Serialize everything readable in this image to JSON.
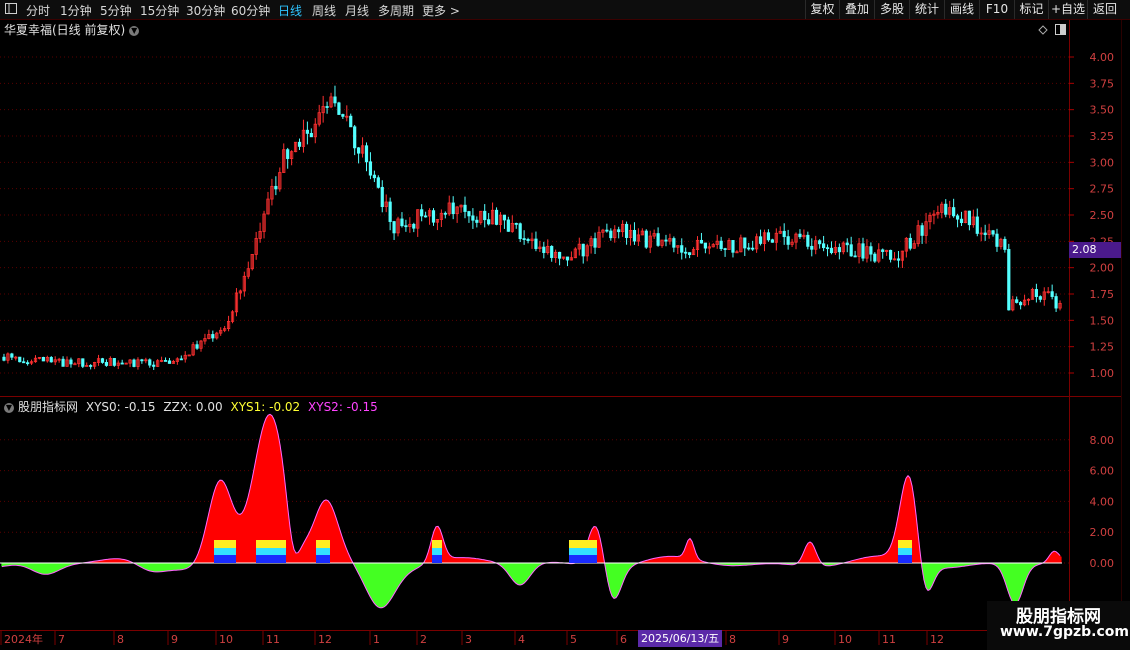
{
  "toolbar": {
    "periods": [
      "分时",
      "1分钟",
      "5分钟",
      "15分钟",
      "30分钟",
      "60分钟",
      "日线",
      "周线",
      "月线",
      "多周期",
      "更多 >"
    ],
    "active": "日线",
    "actions": [
      "复权",
      "叠加",
      "多股",
      "统计",
      "画线",
      "F10",
      "标记",
      "+自选",
      "返回"
    ]
  },
  "chart_header": {
    "title": "华夏幸福(日线 前复权)"
  },
  "price_axis": {
    "ticks": [
      "4.00",
      "3.75",
      "3.50",
      "3.25",
      "3.00",
      "2.75",
      "2.50",
      "2.25",
      "2.00",
      "1.75",
      "1.50",
      "1.25",
      "1.00"
    ],
    "current": "2.08"
  },
  "indicator": {
    "name": "股朋指标网",
    "xys0": "XYS0: -0.15",
    "zzx": "ZZX: 0.00",
    "xys1": "XYS1: -0.02",
    "xys2": "XYS2: -0.15",
    "ticks": [
      "8.00",
      "6.00",
      "4.00",
      "2.00",
      "0.00"
    ]
  },
  "time_axis": {
    "labels": [
      "2024年",
      "7",
      "8",
      "9",
      "10",
      "11",
      "12",
      "1",
      "2",
      "3",
      "4",
      "5",
      "6",
      "7",
      "8",
      "9",
      "10",
      "11",
      "12"
    ],
    "cursor_date": "2025/06/13/五"
  },
  "watermark": {
    "title": "股朋指标网",
    "url": "www.7gpzb.com"
  },
  "colors": {
    "up": "#ff3030",
    "down": "#54ffff",
    "bg": "#000000",
    "grid": "#5a0000",
    "accent": "#2ec4ff",
    "pos_area": "#ff0000",
    "neg_area": "#44ff22"
  },
  "chart_data": {
    "type": "candlestick",
    "title": "华夏幸福(日线 前复权)",
    "price_ylim": [
      0.95,
      4.15
    ],
    "months": [
      "2024-06",
      "7",
      "8",
      "9",
      "10",
      "11",
      "12",
      "2025-01",
      "2",
      "3",
      "4",
      "5",
      "6",
      "7",
      "8",
      "9",
      "10",
      "11",
      "12"
    ],
    "monthly_close_approx": [
      1.15,
      1.1,
      1.1,
      1.08,
      1.45,
      3.0,
      3.6,
      2.4,
      2.55,
      2.45,
      2.05,
      2.35,
      2.2,
      2.2,
      2.3,
      2.2,
      2.1,
      2.6,
      2.2
    ],
    "last_segment_close_approx": [
      1.6,
      1.8,
      1.65
    ],
    "indicator_series": {
      "name": "XYS0",
      "ylim": [
        -2.5,
        9.5
      ],
      "peaks": [
        {
          "month": "10",
          "value": 5.4
        },
        {
          "month": "11",
          "value": 9.5
        },
        {
          "month": "12",
          "value": 3.9
        },
        {
          "month": "5",
          "value": 2.9
        },
        {
          "month": "11",
          "value": 5.7
        }
      ]
    }
  }
}
